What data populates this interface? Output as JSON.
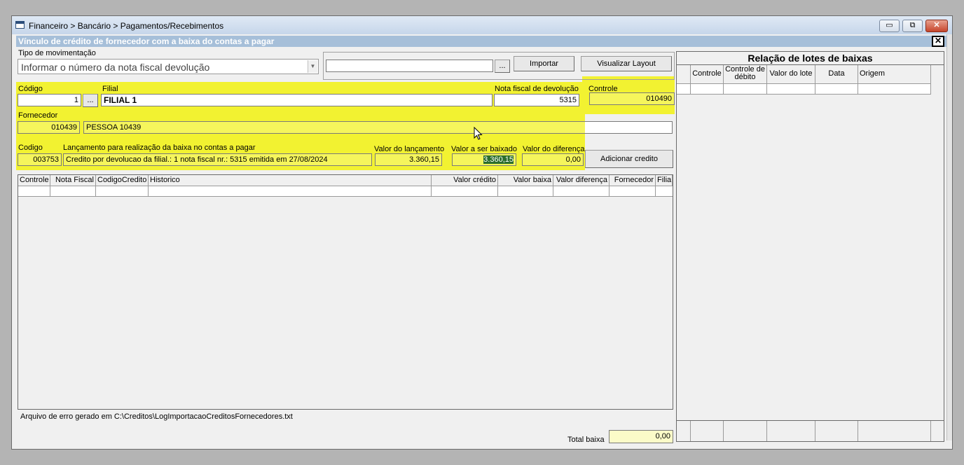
{
  "window": {
    "title": "Financeiro > Bancário > Pagamentos/Recebimentos",
    "minimize": "▭",
    "restore": "⧉",
    "close": "✕"
  },
  "form": {
    "title": "Vínculo de crédito de fornecedor com a baixa do contas a pagar",
    "close": "✕"
  },
  "tipo": {
    "label": "Tipo de  movimentação",
    "value": "Informar o número da nota fiscal devolução"
  },
  "import": {
    "path_value": "",
    "browse_label": "...",
    "import_label": "Importar",
    "layout_label": "Visualizar Layout"
  },
  "codigo": {
    "label": "Código",
    "value": "1",
    "browse_label": "..."
  },
  "filial": {
    "label": "Filial",
    "value": "FILIAL 1"
  },
  "nota": {
    "label": "Nota fiscal de devolução",
    "value": "5315"
  },
  "controle": {
    "label": "Controle",
    "value": "010490"
  },
  "fornecedor": {
    "label": "Fornecedor",
    "code": "010439",
    "name": "PESSOA 10439"
  },
  "lancamento": {
    "codigo_label": "Codigo",
    "codigo_value": "003753",
    "desc_label": "Lançamento para realização da baixa no contas a pagar",
    "desc_value": "Credito por devolucao da filial.: 1 nota fiscal  nr.: 5315 emitida em 27/08/2024",
    "valor_label": "Valor do lançamento",
    "valor_value": "3.360,15",
    "baixar_label": "Valor a ser baixado",
    "baixar_value": "3.360,15",
    "dif_label": "Valor do diferença",
    "dif_value": "0,00",
    "add_label": "Adicionar credito"
  },
  "main_grid": {
    "columns": [
      "Controle",
      "Nota Fiscal",
      "CodigoCredito",
      "Historico",
      "Valor crédito",
      "Valor baixa",
      "Valor diferença",
      "Fornecedor",
      "Filia"
    ]
  },
  "lotes": {
    "title": "Relação de lotes de baixas",
    "columns": [
      "Controle",
      "Controle de débito",
      "Valor do lote",
      "Data",
      "Origem"
    ]
  },
  "status": {
    "log": "Arquivo de erro gerado em C:\\Creditos\\LogImportacaoCreditosFornecedores.txt",
    "total_label": "Total baixa",
    "total_value": "0,00"
  }
}
